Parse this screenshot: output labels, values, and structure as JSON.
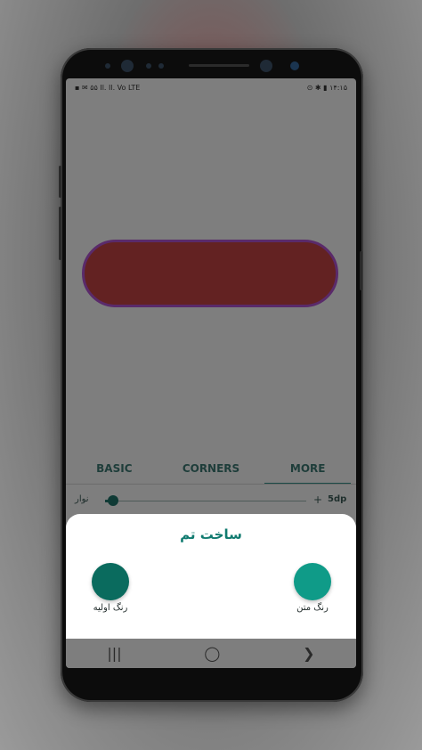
{
  "status_bar": {
    "left": "▪ ✉ ۵۵ Il. Il. Vo LTE",
    "right": "⊙ ✱ ▮ ۱۴:۱۵"
  },
  "tabs": [
    {
      "label": "BASIC",
      "active": false
    },
    {
      "label": "CORNERS",
      "active": false
    },
    {
      "label": "MORE",
      "active": true
    }
  ],
  "stroke_slider": {
    "label": "نوار",
    "plus_label": "+",
    "value_text": "5dp",
    "fraction": 0.04
  },
  "sheet": {
    "title": "ساخت تم",
    "primary": {
      "label": "رنگ اولیه",
      "color": "#0a6b5e"
    },
    "text": {
      "label": "رنگ متن",
      "color": "#0f9b88"
    }
  },
  "nav": {
    "recents": "|||",
    "home": "◯",
    "back": "❯"
  },
  "colors": {
    "pill_fill": "#632222",
    "pill_border": "#5a2a6a",
    "accent": "#117b70"
  }
}
